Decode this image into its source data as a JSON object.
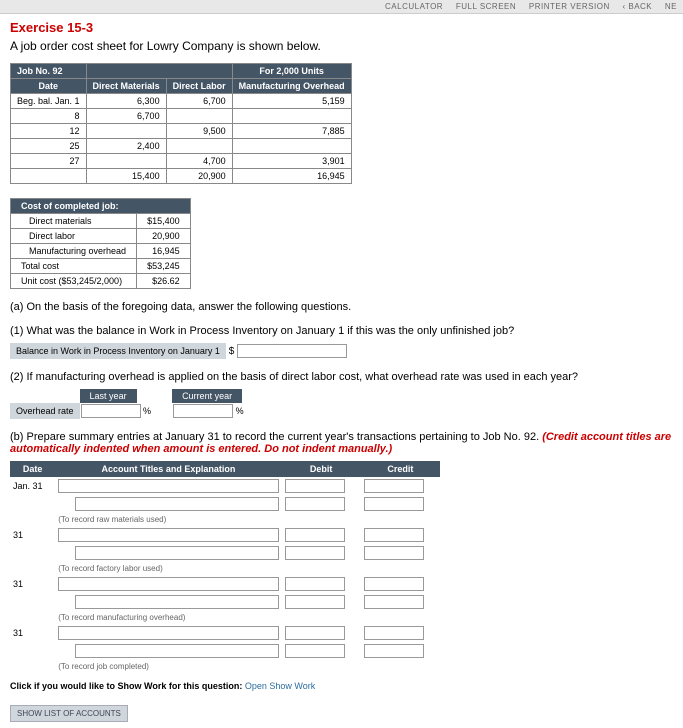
{
  "topbar": {
    "calc": "CALCULATOR",
    "full": "FULL SCREEN",
    "printer": "PRINTER VERSION",
    "back": "‹ BACK",
    "next": "NE"
  },
  "exercise": {
    "title": "Exercise 15-3",
    "desc": "A job order cost sheet for Lowry Company is shown below."
  },
  "jobtable": {
    "jobno": "Job No. 92",
    "for": "For 2,000 Units",
    "h_date": "Date",
    "h_dm": "Direct Materials",
    "h_dl": "Direct Labor",
    "h_mo": "Manufacturing Overhead",
    "rows": [
      {
        "date": "Beg. bal. Jan. 1",
        "dm": "6,300",
        "dl": "6,700",
        "mo": "5,159"
      },
      {
        "date": "8",
        "dm": "6,700",
        "dl": "",
        "mo": ""
      },
      {
        "date": "12",
        "dm": "",
        "dl": "9,500",
        "mo": "7,885"
      },
      {
        "date": "25",
        "dm": "2,400",
        "dl": "",
        "mo": ""
      },
      {
        "date": "27",
        "dm": "",
        "dl": "4,700",
        "mo": "3,901"
      }
    ],
    "totals": {
      "dm": "15,400",
      "dl": "20,900",
      "mo": "16,945"
    }
  },
  "costtable": {
    "hdr": "Cost of completed job:",
    "rows": [
      {
        "label": "Direct materials",
        "val": "$15,400"
      },
      {
        "label": "Direct labor",
        "val": "20,900"
      },
      {
        "label": "Manufacturing overhead",
        "val": "16,945"
      }
    ],
    "totallabel": "Total cost",
    "totalval": "$53,245",
    "unitlabel": "Unit cost ($53,245/2,000)",
    "unitval": "$26.62"
  },
  "qa": {
    "a": "(a) On the basis of the foregoing data, answer the following questions.",
    "q1": "(1) What was the balance in Work in Process Inventory on January 1 if this was the only unfinished job?",
    "q1prompt": "Balance in Work in Process Inventory on January 1",
    "q2": "(2) If manufacturing overhead is applied on the basis of direct labor cost, what overhead rate was used in each year?",
    "last": "Last year",
    "current": "Current year",
    "ovrlabel": "Overhead rate"
  },
  "partb": {
    "text1": "(b) Prepare summary entries at January 31 to record the current year's transactions pertaining to Job No. 92. ",
    "text2": "(Credit account titles are automatically indented when amount is entered. Do not indent manually.)",
    "h_date": "Date",
    "h_acct": "Account Titles and Explanation",
    "h_debit": "Debit",
    "h_credit": "Credit",
    "rows": [
      {
        "date": "Jan. 31",
        "hint": "(To record raw materials used)"
      },
      {
        "date": "31",
        "hint": "(To record factory labor used)"
      },
      {
        "date": "31",
        "hint": "(To record manufacturing overhead)"
      },
      {
        "date": "31",
        "hint": "(To record job completed)"
      }
    ]
  },
  "footer": {
    "click": "Click if you would like to Show Work for this question:",
    "link": "Open Show Work",
    "showlist": "SHOW LIST OF ACCOUNTS"
  }
}
